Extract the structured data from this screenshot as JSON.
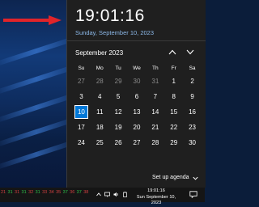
{
  "flyout": {
    "time": "19:01:16",
    "date_long": "Sunday, September 10, 2023",
    "month_label": "September 2023",
    "weekdays": [
      "Su",
      "Mo",
      "Tu",
      "We",
      "Th",
      "Fr",
      "Sa"
    ],
    "weeks": [
      [
        "27",
        "28",
        "29",
        "30",
        "31",
        "1",
        "2"
      ],
      [
        "3",
        "4",
        "5",
        "6",
        "7",
        "8",
        "9"
      ],
      [
        "10",
        "11",
        "12",
        "13",
        "14",
        "15",
        "16"
      ],
      [
        "17",
        "18",
        "19",
        "20",
        "21",
        "22",
        "23"
      ],
      [
        "24",
        "25",
        "26",
        "27",
        "28",
        "29",
        "30"
      ]
    ],
    "muted_days_first_row": 5,
    "today": "10",
    "agenda_label": "Set up agenda"
  },
  "taskbar": {
    "numbers": [
      {
        "text": "21",
        "color": "#d04040"
      },
      {
        "text": "31",
        "color": "#2fbf4a"
      },
      {
        "text": "31",
        "color": "#d04040"
      },
      {
        "text": "31",
        "color": "#2fbf4a"
      },
      {
        "text": "32",
        "color": "#d04040"
      },
      {
        "text": "31",
        "color": "#2fbf4a"
      },
      {
        "text": "33",
        "color": "#d04040"
      },
      {
        "text": "34",
        "color": "#d04040"
      },
      {
        "text": "35",
        "color": "#d04040"
      },
      {
        "text": "37",
        "color": "#2fbf4a"
      },
      {
        "text": "36",
        "color": "#d04040"
      },
      {
        "text": "37",
        "color": "#2fbf4a"
      },
      {
        "text": "38",
        "color": "#d04040"
      }
    ],
    "clock_time": "19:01:16",
    "clock_date": "Sun September 10, 2023"
  },
  "colors": {
    "accent": "#0078d7",
    "arrow": "#e0242a",
    "panel_bg": "#1f1f1f",
    "link": "#8cb8e8"
  }
}
